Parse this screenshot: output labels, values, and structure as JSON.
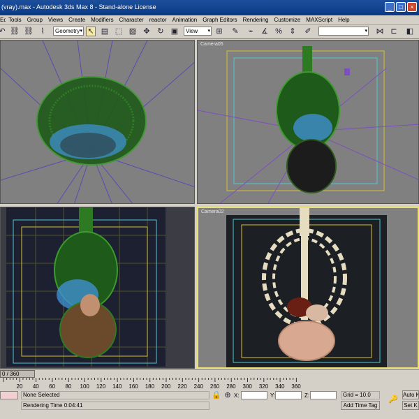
{
  "window": {
    "title": "(vray).max - Autodesk 3ds Max 8 - Stand-alone License"
  },
  "menu": [
    "Edit",
    "Tools",
    "Group",
    "Views",
    "Create",
    "Modifiers",
    "Character",
    "reactor",
    "Animation",
    "Graph Editors",
    "Rendering",
    "Customize",
    "MAXScript",
    "Help"
  ],
  "toolbar": {
    "selection_filter": "Geometry",
    "reference_coord": "View",
    "named_selection": ""
  },
  "viewports": {
    "top_left": {
      "label": ""
    },
    "top_right": {
      "label": "Camera05"
    },
    "bottom_left": {
      "label": ""
    },
    "bottom_right": {
      "label": "Camera02"
    }
  },
  "timeline": {
    "frame_display": "0 / 360",
    "ticks": [
      "20",
      "40",
      "60",
      "80",
      "100",
      "120",
      "140",
      "160",
      "180",
      "200",
      "220",
      "240",
      "260",
      "280",
      "300",
      "320",
      "340",
      "360"
    ]
  },
  "status": {
    "selection": "None Selected",
    "rendering_time": "Rendering Time  0:04:41",
    "x_label": "X:",
    "y_label": "Y:",
    "z_label": "Z:",
    "x_value": "",
    "y_value": "",
    "z_value": "",
    "grid": "Grid = 10.0",
    "add_time_tag": "Add Time Tag",
    "auto_key": "Auto K",
    "set_key": "Set K"
  },
  "colors": {
    "title_bar": "#0a3a86",
    "chrome": "#d4d0c8",
    "viewport_gray": "#808080",
    "viewport_dark": "#3c3c44",
    "active_border": "#e8e070",
    "safe_frame_yellow": "#d8c030",
    "safe_frame_cyan": "#50c8d8",
    "wire_green": "#2e7a22",
    "organ_blue": "#3f8fd0",
    "bone": "#e6dcc0"
  }
}
